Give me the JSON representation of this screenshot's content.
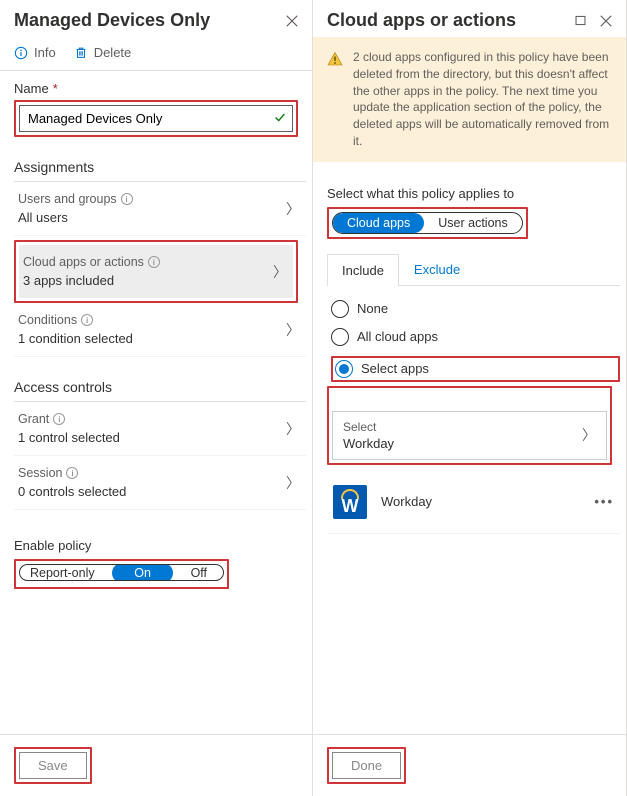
{
  "left": {
    "title": "Managed Devices Only",
    "toolbar": {
      "info": "Info",
      "delete": "Delete"
    },
    "nameLabel": "Name",
    "nameValue": "Managed Devices Only",
    "assignmentsTitle": "Assignments",
    "rows": {
      "users": {
        "label": "Users and groups",
        "value": "All users"
      },
      "apps": {
        "label": "Cloud apps or actions",
        "value": "3 apps included"
      },
      "conditions": {
        "label": "Conditions",
        "value": "1 condition selected"
      }
    },
    "accessTitle": "Access controls",
    "accessRows": {
      "grant": {
        "label": "Grant",
        "value": "1 control selected"
      },
      "session": {
        "label": "Session",
        "value": "0 controls selected"
      }
    },
    "enableLabel": "Enable policy",
    "pills": {
      "report": "Report-only",
      "on": "On",
      "off": "Off"
    },
    "save": "Save"
  },
  "right": {
    "title": "Cloud apps or actions",
    "warning": "2 cloud apps configured in this policy have been deleted from the directory, but this doesn't affect the other apps in the policy. The next time you update the application section of the policy, the deleted apps will be automatically removed from it.",
    "selectWhat": "Select what this policy applies to",
    "modePills": {
      "cloud": "Cloud apps",
      "user": "User actions"
    },
    "tabs": {
      "include": "Include",
      "exclude": "Exclude"
    },
    "radios": {
      "none": "None",
      "all": "All cloud apps",
      "select": "Select apps"
    },
    "selectBox": {
      "label": "Select",
      "value": "Workday"
    },
    "app": {
      "name": "Workday",
      "initial": "W"
    },
    "done": "Done"
  }
}
